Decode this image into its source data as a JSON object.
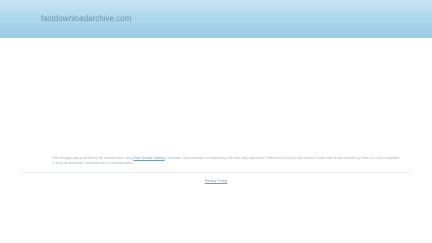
{
  "header": {
    "domain": "fastdownloadarchive.com"
  },
  "footer": {
    "disclaimer_start": "This webpage was generated by the domain owner using ",
    "disclaimer_link": "Sedo Domain Parking",
    "disclaimer_end": ". Disclaimer: Sedo maintains no relationship with third party advertisers. Reference to any specific service or trade mark is not controlled by Sedo nor does it constitute or imply its association, endorsement or recommendation.",
    "privacy_label": "Privacy Policy"
  }
}
